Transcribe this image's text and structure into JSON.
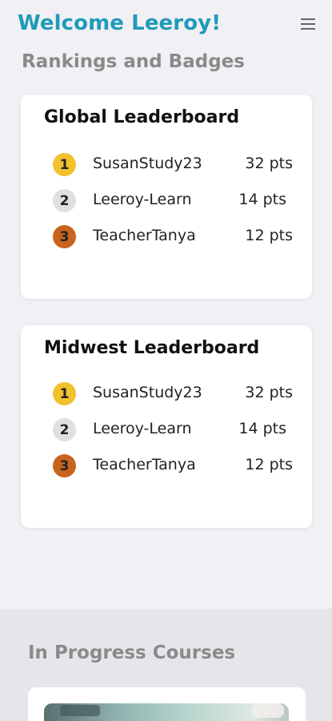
{
  "header": {
    "welcome": "Welcome Leeroy!",
    "menu_icon": "hamburger-menu-icon"
  },
  "rankings": {
    "title": "Rankings and Badges",
    "leaderboards": [
      {
        "title": "Global Leaderboard",
        "entries": [
          {
            "rank": "1",
            "name": "SusanStudy23",
            "points": "32 pts",
            "medal_color": "#f2c12e"
          },
          {
            "rank": "2",
            "name": "Leeroy-Learn",
            "points": "14 pts",
            "medal_color": "#e0e0e0"
          },
          {
            "rank": "3",
            "name": "TeacherTanya",
            "points": "12 pts",
            "medal_color": "#c8641e"
          }
        ]
      },
      {
        "title": "Midwest Leaderboard",
        "entries": [
          {
            "rank": "1",
            "name": "SusanStudy23",
            "points": "32 pts",
            "medal_color": "#f2c12e"
          },
          {
            "rank": "2",
            "name": "Leeroy-Learn",
            "points": "14 pts",
            "medal_color": "#e0e0e0"
          },
          {
            "rank": "3",
            "name": "TeacherTanya",
            "points": "12 pts",
            "medal_color": "#c8641e"
          }
        ]
      }
    ]
  },
  "courses": {
    "title": "In Progress Courses"
  },
  "colors": {
    "accent": "#1f9bb9",
    "muted_heading": "#8a8a8a",
    "gold": "#f2c12e",
    "silver": "#e0e0e0",
    "bronze": "#c8641e"
  }
}
